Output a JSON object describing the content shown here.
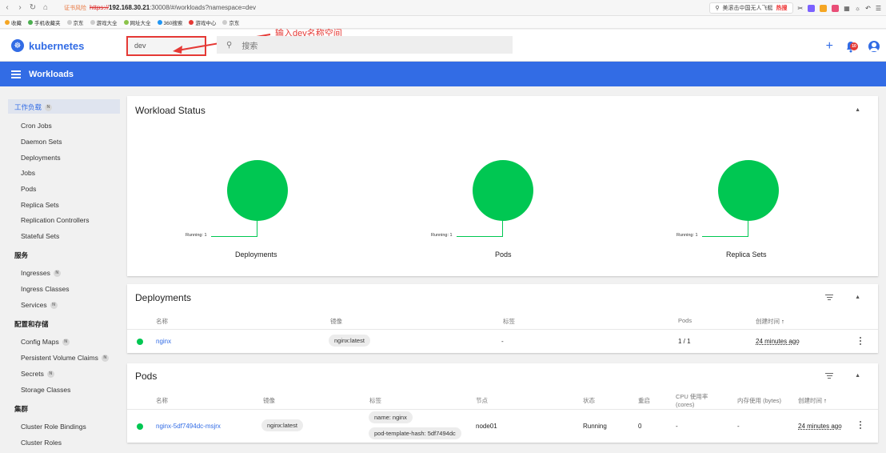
{
  "browser": {
    "cert_warning": "证书风险",
    "url_https": "https://",
    "url_host": "192.168.30.21",
    "url_rest": ":30008/#/workloads?namespace=dev",
    "search_text": "美滚击中国无人飞艇",
    "hot_label": "热搜",
    "bookmarks": [
      "收藏",
      "手机收藏夹",
      "京东",
      "游戏大全",
      "网址大全",
      "360搜索",
      "游戏中心",
      "京东"
    ]
  },
  "header": {
    "logo_text": "kubernetes",
    "namespace_value": "dev",
    "search_placeholder": "搜索",
    "annotation": "输入dev名称空间",
    "notification_count": "10"
  },
  "titlebar": {
    "title": "Workloads"
  },
  "sidebar": {
    "active": "工作负载",
    "workload_items": [
      "Cron Jobs",
      "Daemon Sets",
      "Deployments",
      "Jobs",
      "Pods",
      "Replica Sets",
      "Replication Controllers",
      "Stateful Sets"
    ],
    "service_section": "服务",
    "service_items": [
      "Ingresses",
      "Ingress Classes",
      "Services"
    ],
    "config_section": "配置和存储",
    "config_items": [
      "Config Maps",
      "Persistent Volume Claims",
      "Secrets",
      "Storage Classes"
    ],
    "cluster_section": "集群",
    "cluster_items": [
      "Cluster Role Bindings",
      "Cluster Roles"
    ],
    "n_badge": "N"
  },
  "colors": {
    "accent": "#326ce5",
    "running": "#00c752",
    "annotation": "#e53935"
  },
  "workload_status": {
    "title": "Workload Status",
    "charts": [
      {
        "label": "Deployments",
        "running_text": "Running: 1"
      },
      {
        "label": "Pods",
        "running_text": "Running: 1"
      },
      {
        "label": "Replica Sets",
        "running_text": "Running: 1"
      }
    ]
  },
  "deployments": {
    "title": "Deployments",
    "columns": [
      "名称",
      "镜像",
      "标签",
      "Pods",
      "创建时间"
    ],
    "sort_icon": "↑",
    "rows": [
      {
        "name": "nginx",
        "image": "nginx:latest",
        "labels": "-",
        "pods": "1 / 1",
        "created": "24 minutes ago"
      }
    ]
  },
  "pods": {
    "title": "Pods",
    "columns": [
      "名称",
      "镜像",
      "标签",
      "节点",
      "状态",
      "重启",
      "CPU 使用率 (cores)",
      "内存使用 (bytes)",
      "创建时间"
    ],
    "cpu_col_line1": "CPU 使用率",
    "cpu_col_line2": "(cores)",
    "sort_icon": "↑",
    "rows": [
      {
        "name": "nginx-5df7494dc-msjrx",
        "image": "nginx:latest",
        "label1": "name: nginx",
        "label2": "pod-template-hash: 5df7494dc",
        "node": "node01",
        "status": "Running",
        "restarts": "0",
        "cpu": "-",
        "memory": "-",
        "created": "24 minutes ago"
      }
    ]
  }
}
